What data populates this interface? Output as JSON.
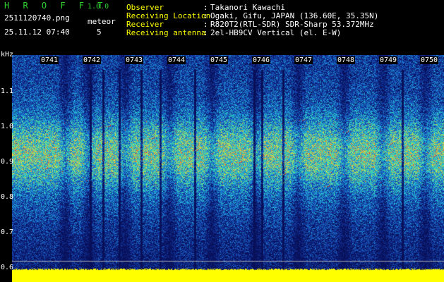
{
  "header": {
    "app_name": "H R O F F T",
    "version": "1.0.0",
    "filename": "2511120740.png",
    "datetime": "25.11.12 07:40",
    "meteor_label": "meteor",
    "meteor_count": "5"
  },
  "info": [
    {
      "key": "Observer",
      "value": "Takanori Kawachi"
    },
    {
      "key": "Receiving Location",
      "value": "Ogaki, Gifu, JAPAN (136.60E, 35.35N)"
    },
    {
      "key": "Receiver",
      "value": "R820T2(RTL-SDR) SDR-Sharp 53.372MHz"
    },
    {
      "key": "Receiving antenna",
      "value": "2el-HB9CV Vertical (el. E-W)"
    }
  ],
  "separator": ":",
  "spectrogram": {
    "y_unit": "kHz",
    "y_ticks": [
      "1.1",
      "1.0",
      "0.9",
      "0.8",
      "0.7",
      "0.6"
    ],
    "time_ticks": [
      "0741",
      "0742",
      "0743",
      "0744",
      "0745",
      "0746",
      "0747",
      "0748",
      "0749",
      "0750"
    ],
    "colors": {
      "low": "#0a1a6e",
      "mid": "#1a8cd8",
      "high": "#e03030",
      "floor": "#ffff00"
    }
  }
}
